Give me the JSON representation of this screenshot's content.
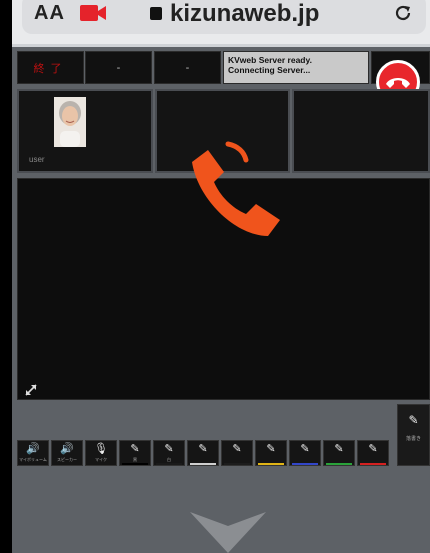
{
  "browser": {
    "text_size_label": "AA",
    "domain": "kizunaweb.jp"
  },
  "header": {
    "end_label": "終了",
    "slot2_label": "-",
    "slot3_label": "-",
    "status_lines": [
      "KVweb Server ready.",
      "Connecting Server..."
    ]
  },
  "participants": [
    {
      "name": "user"
    }
  ],
  "toolbar": {
    "buttons": [
      {
        "icon": "speaker-icon",
        "glyph": "🔊",
        "label": "マイボリューム"
      },
      {
        "icon": "speaker-icon",
        "glyph": "🔊",
        "label": "スピーカー"
      },
      {
        "icon": "mic-icon",
        "glyph": "🎙",
        "label": "マイク"
      },
      {
        "icon": "pen-icon",
        "glyph": "✎",
        "label": "黒",
        "color": "#000000"
      },
      {
        "icon": "pen-icon",
        "glyph": "✎",
        "label": "白",
        "color": "#1a1a1a"
      },
      {
        "icon": "pen-icon",
        "glyph": "✎",
        "label": "",
        "color": "#cfcfcf"
      },
      {
        "icon": "pen-icon",
        "glyph": "✎",
        "label": "",
        "color": "#1c1c1c"
      },
      {
        "icon": "pen-icon",
        "glyph": "✎",
        "label": "",
        "color": "#e0b416"
      },
      {
        "icon": "pen-icon",
        "glyph": "✎",
        "label": "",
        "color": "#3246c8"
      },
      {
        "icon": "pen-icon",
        "glyph": "✎",
        "label": "",
        "color": "#2aa23a"
      },
      {
        "icon": "pen-icon",
        "glyph": "✎",
        "label": "",
        "color": "#d42020"
      }
    ],
    "side": {
      "icon": "pen-icon",
      "glyph": "✎",
      "label": "落書き"
    }
  },
  "colors": {
    "hangup": "#e8262c",
    "call_icon": "#f0541c",
    "panel_bg": "#5d6166"
  }
}
